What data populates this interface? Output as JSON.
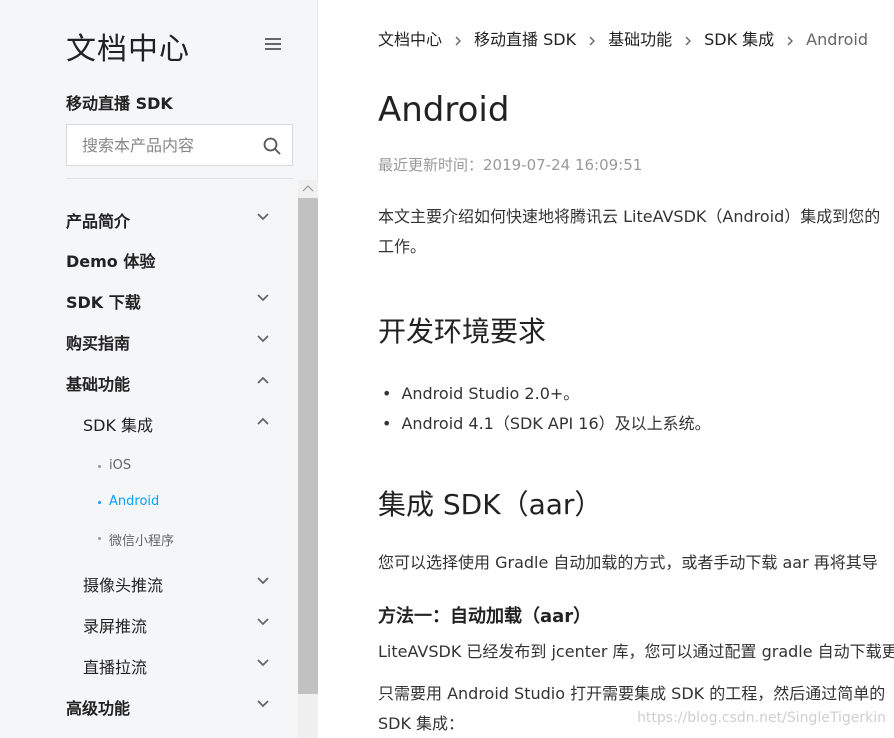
{
  "sidebar": {
    "logo": "文档中心",
    "product": "移动直播 SDK",
    "search_placeholder": "搜索本产品内容",
    "nav": [
      {
        "label": "产品简介"
      },
      {
        "label": "Demo 体验"
      },
      {
        "label": "SDK 下载"
      },
      {
        "label": "购买指南"
      },
      {
        "label": "基础功能"
      },
      {
        "label": "SDK 集成"
      },
      {
        "label": "摄像头推流"
      },
      {
        "label": "录屏推流"
      },
      {
        "label": "直播拉流"
      },
      {
        "label": "高级功能"
      }
    ],
    "sub_items": [
      {
        "label": "iOS"
      },
      {
        "label": "Android"
      },
      {
        "label": "微信小程序"
      }
    ]
  },
  "breadcrumb": [
    "文档中心",
    "移动直播 SDK",
    "基础功能",
    "SDK 集成",
    "Android"
  ],
  "main": {
    "title": "Android",
    "updated": "最近更新时间：2019-07-24 16:09:51",
    "intro_line1": "本文主要介绍如何快速地将腾讯云 LiteAVSDK（Android）集成到您的",
    "intro_line2": "工作。",
    "h2_env": "开发环境要求",
    "env_items": [
      "Android Studio 2.0+。",
      "Android 4.1（SDK API 16）及以上系统。"
    ],
    "h2_integrate": "集成 SDK（aar）",
    "integrate_para": "您可以选择使用 Gradle 自动加载的方式，或者手动下载 aar 再将其导",
    "h3_method1": "方法一：自动加载（aar）",
    "method1_para": "LiteAVSDK 已经发布到 jcenter 库，您可以通过配置 gradle 自动下载更",
    "method1_para2_line1": "只需要用 Android Studio 打开需要集成 SDK 的工程，然后通过简单的",
    "method1_para2_line2": "SDK 集成："
  },
  "watermark": "https://blog.csdn.net/SingleTigerkin",
  "colors": {
    "accent": "#00a4ff",
    "sidebar_bg": "#f5f6f8"
  }
}
